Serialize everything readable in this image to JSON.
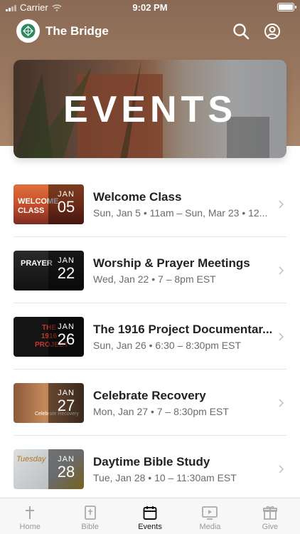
{
  "status_bar": {
    "carrier": "Carrier",
    "time": "9:02 PM"
  },
  "header": {
    "title": "The Bridge"
  },
  "hero": {
    "title": "EVENTS"
  },
  "events": [
    {
      "title": "Welcome Class",
      "subtitle": "Sun, Jan 5 • 11am – Sun, Mar 23 • 12...",
      "month": "JAN",
      "day": "05",
      "thumb_text": "WELCOME CLASS",
      "thumb_color": "#c64f2c"
    },
    {
      "title": "Worship & Prayer Meetings",
      "subtitle": "Wed, Jan 22 • 7 – 8pm EST",
      "month": "JAN",
      "day": "22",
      "thumb_text": "PRAYER",
      "thumb_color": "#1c1c1c"
    },
    {
      "title": "The 1916 Project Documentar...",
      "subtitle": "Sun, Jan 26 • 6:30 – 8:30pm EST",
      "month": "JAN",
      "day": "26",
      "thumb_text": "THE 1916 PROJECT",
      "thumb_color": "#141414"
    },
    {
      "title": "Celebrate Recovery",
      "subtitle": "Mon, Jan 27 • 7 – 8:30pm EST",
      "month": "JAN",
      "day": "27",
      "thumb_text": "Celebrate Recovery",
      "thumb_color": "#6b4a35"
    },
    {
      "title": "Daytime Bible Study",
      "subtitle": "Tue, Jan 28 • 10 – 11:30am EST",
      "month": "JAN",
      "day": "28",
      "thumb_text": "Tuesday",
      "thumb_color": "#c9ccd0"
    }
  ],
  "tabs": [
    {
      "label": "Home",
      "icon": "cross-icon"
    },
    {
      "label": "Bible",
      "icon": "bible-icon"
    },
    {
      "label": "Events",
      "icon": "calendar-icon",
      "active": true
    },
    {
      "label": "Media",
      "icon": "play-icon"
    },
    {
      "label": "Give",
      "icon": "gift-icon"
    }
  ],
  "colors": {
    "header_brown": "#9c7a61",
    "active_tab": "#111111",
    "inactive_tab": "#999999"
  }
}
